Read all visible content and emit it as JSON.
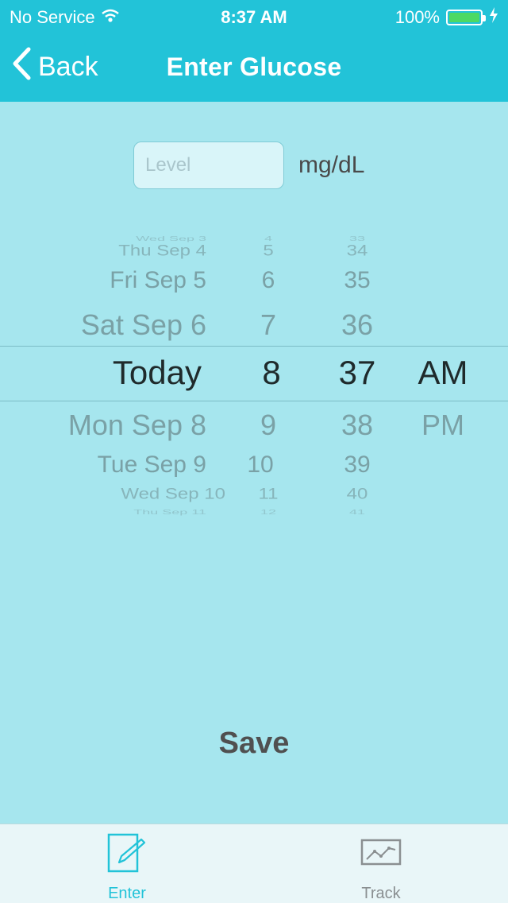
{
  "status_bar": {
    "carrier": "No Service",
    "time": "8:37 AM",
    "battery": "100%",
    "battery_level": 1.0
  },
  "nav": {
    "back_label": "Back",
    "title": "Enter Glucose"
  },
  "level": {
    "placeholder": "Level",
    "value": "",
    "unit": "mg/dL"
  },
  "picker": {
    "dates": [
      "Wed Sep 3",
      "Thu Sep 4",
      "Fri Sep 5",
      "Sat Sep 6",
      "Today",
      "Mon Sep 8",
      "Tue Sep 9",
      "Wed Sep 10",
      "Thu Sep 11"
    ],
    "hours": [
      "4",
      "5",
      "6",
      "7",
      "8",
      "9",
      "10",
      "11",
      "12"
    ],
    "minutes": [
      "33",
      "34",
      "35",
      "36",
      "37",
      "38",
      "39",
      "40",
      "41"
    ],
    "ampm": [
      "AM",
      "PM"
    ]
  },
  "save_label": "Save",
  "tabs": [
    {
      "label": "Enter",
      "icon": "pencil-icon",
      "selected": true
    },
    {
      "label": "Track",
      "icon": "chart-icon",
      "selected": false
    }
  ],
  "colors": {
    "accent": "#22c3d8",
    "background": "#a6e6ee",
    "battery_fill": "#4cd964"
  }
}
